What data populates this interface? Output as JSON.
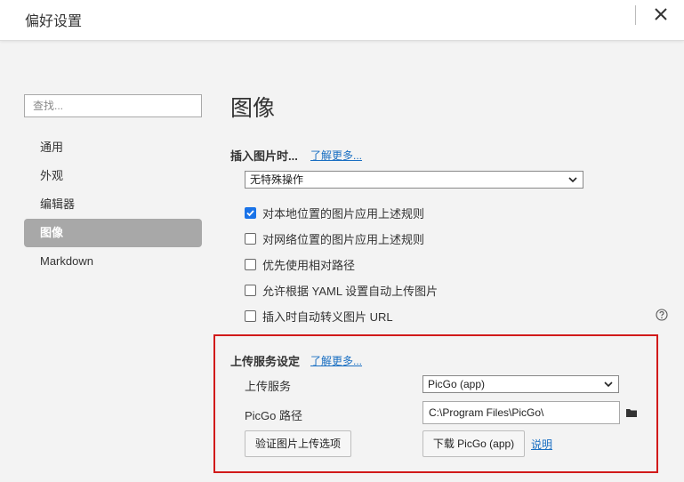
{
  "window": {
    "title": "偏好设置"
  },
  "sidebar": {
    "search_placeholder": "查找...",
    "items": [
      {
        "label": "通用",
        "active": false
      },
      {
        "label": "外观",
        "active": false
      },
      {
        "label": "编辑器",
        "active": false
      },
      {
        "label": "图像",
        "active": true
      },
      {
        "label": "Markdown",
        "active": false
      }
    ]
  },
  "main": {
    "title": "图像",
    "insert": {
      "label": "插入图片时...",
      "learn_more": "了解更多...",
      "select_value": "无特殊操作"
    },
    "options": [
      {
        "label": "对本地位置的图片应用上述规则",
        "checked": true
      },
      {
        "label": "对网络位置的图片应用上述规则",
        "checked": false
      },
      {
        "label": "优先使用相对路径",
        "checked": false
      },
      {
        "label": "允许根据 YAML 设置自动上传图片",
        "checked": false
      },
      {
        "label": "插入时自动转义图片 URL",
        "checked": false
      }
    ],
    "upload": {
      "label": "上传服务设定",
      "learn_more": "了解更多...",
      "service_label": "上传服务",
      "service_value": "PicGo (app)",
      "path_label": "PicGo 路径",
      "path_value": "C:\\Program Files\\PicGo\\",
      "verify_button": "验证图片上传选项",
      "download_button": "下载 PicGo (app)",
      "help_link": "说明"
    }
  }
}
